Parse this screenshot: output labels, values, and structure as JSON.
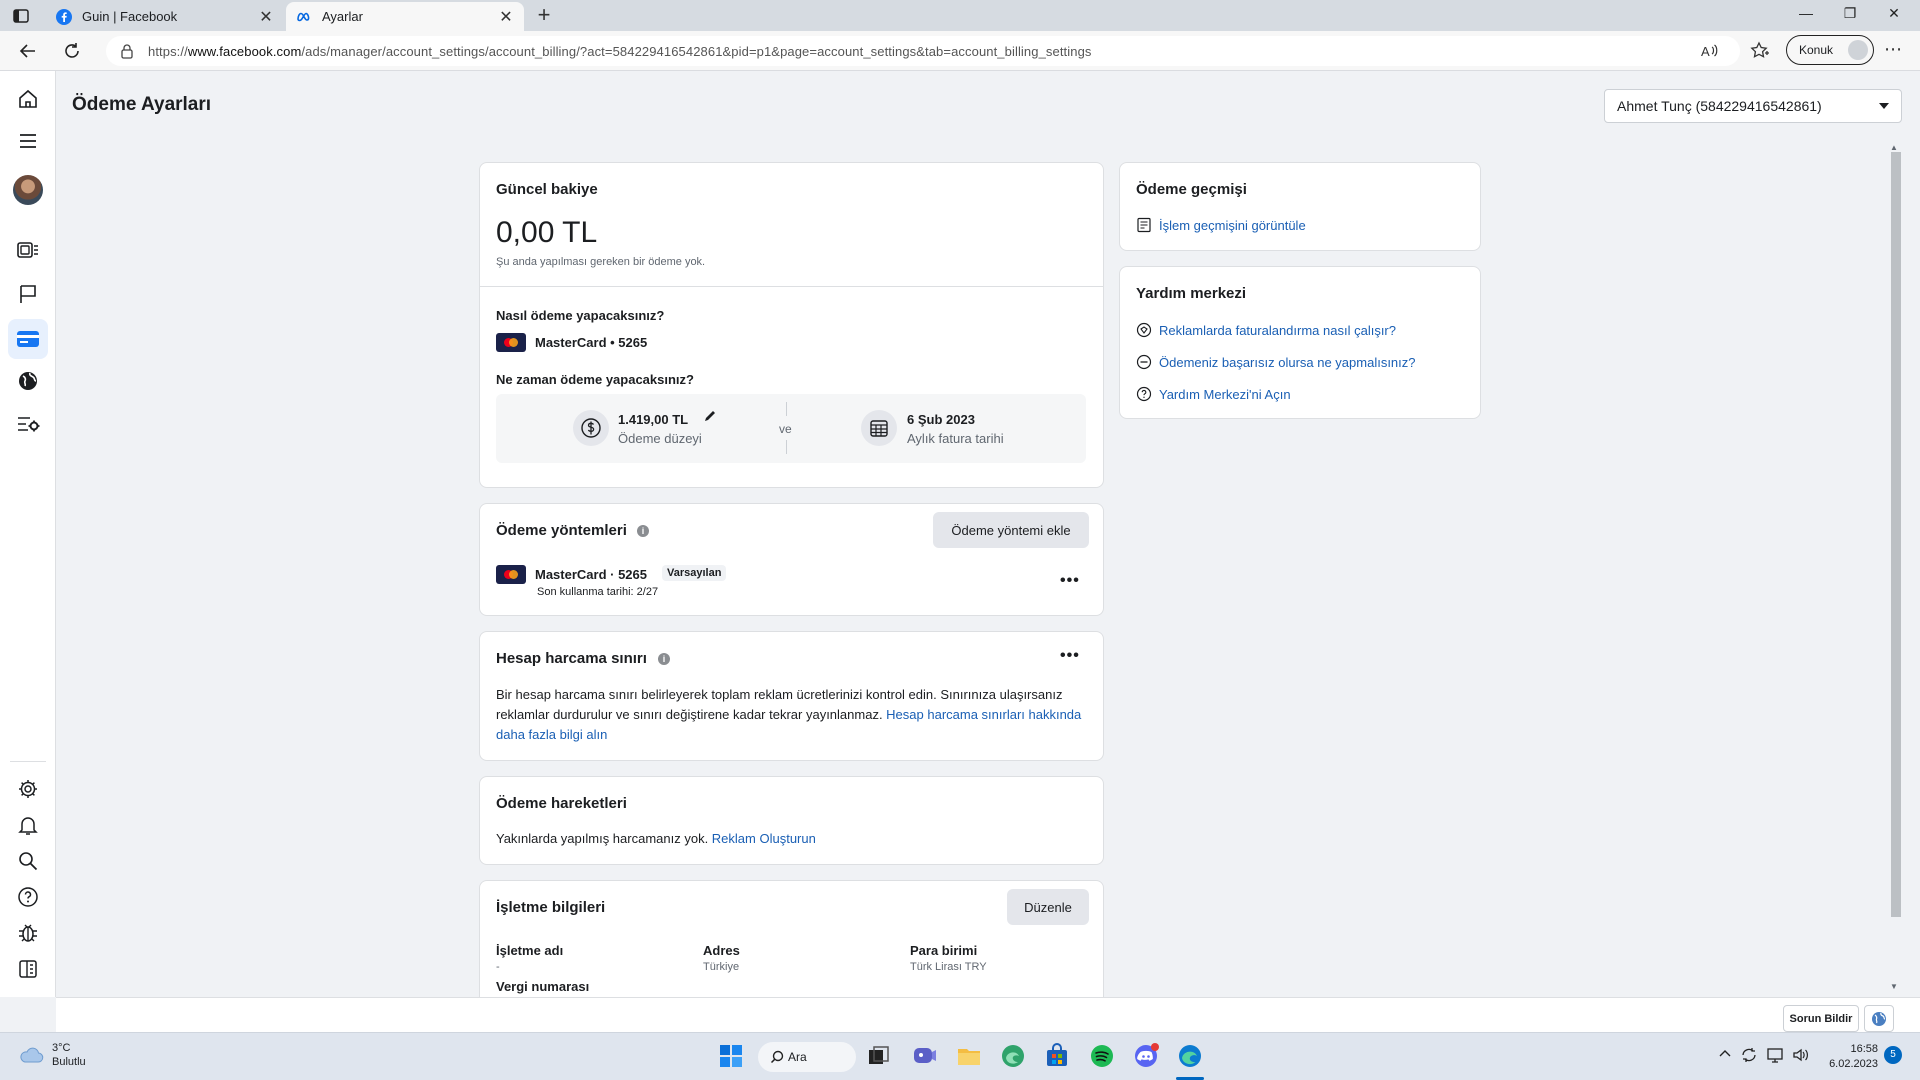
{
  "browser": {
    "tabs": [
      {
        "title": "Guin | Facebook"
      },
      {
        "title": "Ayarlar"
      }
    ],
    "url_prefix": "https://",
    "url_domain": "www.facebook.com",
    "url_path": "/ads/manager/account_settings/account_billing/?act=584229416542861&pid=p1&page=account_settings&tab=account_billing_settings",
    "guest_label": "Konuk"
  },
  "page": {
    "title": "Ödeme Ayarları",
    "account_selector": "Ahmet Tunç (584229416542861)"
  },
  "balance_card": {
    "heading": "Güncel bakiye",
    "amount": "0,00 TL",
    "note": "Şu anda yapılması gereken bir ödeme yok.",
    "how_label": "Nasıl ödeme yapacaksınız?",
    "card_name": "MasterCard • 5265",
    "when_label": "Ne zaman ödeme yapacaksınız?",
    "threshold_value": "1.419,00 TL",
    "threshold_label": "Ödeme düzeyi",
    "and_word": "ve",
    "bill_date": "6 Şub 2023",
    "bill_date_label": "Aylık fatura tarihi"
  },
  "methods_card": {
    "heading": "Ödeme yöntemleri",
    "add_button": "Ödeme yöntemi ekle",
    "card_name": "MasterCard · 5265",
    "default_badge": "Varsayılan",
    "expiry": "Son kullanma tarihi: 2/27"
  },
  "limit_card": {
    "heading": "Hesap harcama sınırı",
    "text": "Bir hesap harcama sınırı belirleyerek toplam reklam ücretlerinizi kontrol edin. Sınırınıza ulaşırsanız reklamlar durdurulur ve sınırı değiştirene kadar tekrar yayınlanmaz. ",
    "link": "Hesap harcama sınırları hakkında daha fazla bilgi alın"
  },
  "activity_card": {
    "heading": "Ödeme hareketleri",
    "text": "Yakınlarda yapılmış harcamanız yok. ",
    "link": "Reklam Oluşturun"
  },
  "business_card": {
    "heading": "İşletme bilgileri",
    "edit_button": "Düzenle",
    "name_label": "İşletme adı",
    "name_value": "-",
    "address_label": "Adres",
    "address_value": "Türkiye",
    "currency_label": "Para birimi",
    "currency_value": "Türk Lirası TRY",
    "tax_label": "Vergi numarası"
  },
  "history_card": {
    "heading": "Ödeme geçmişi",
    "link": "İşlem geçmişini görüntüle"
  },
  "help_card": {
    "heading": "Yardım merkezi",
    "links": [
      "Reklamlarda faturalandırma nasıl çalışır?",
      "Ödemeniz başarısız olursa ne yapmalısınız?",
      "Yardım Merkezi'ni Açın"
    ]
  },
  "footer": {
    "report_button": "Sorun Bildir"
  },
  "taskbar": {
    "temperature": "3°C",
    "condition": "Bulutlu",
    "search_label": "Ara",
    "time": "16:58",
    "date": "6.02.2023",
    "notification_count": "5"
  },
  "colors": {
    "link": "#1a5fb4",
    "active_rail": "#1877f2",
    "page_bg": "#f0f2f5"
  }
}
